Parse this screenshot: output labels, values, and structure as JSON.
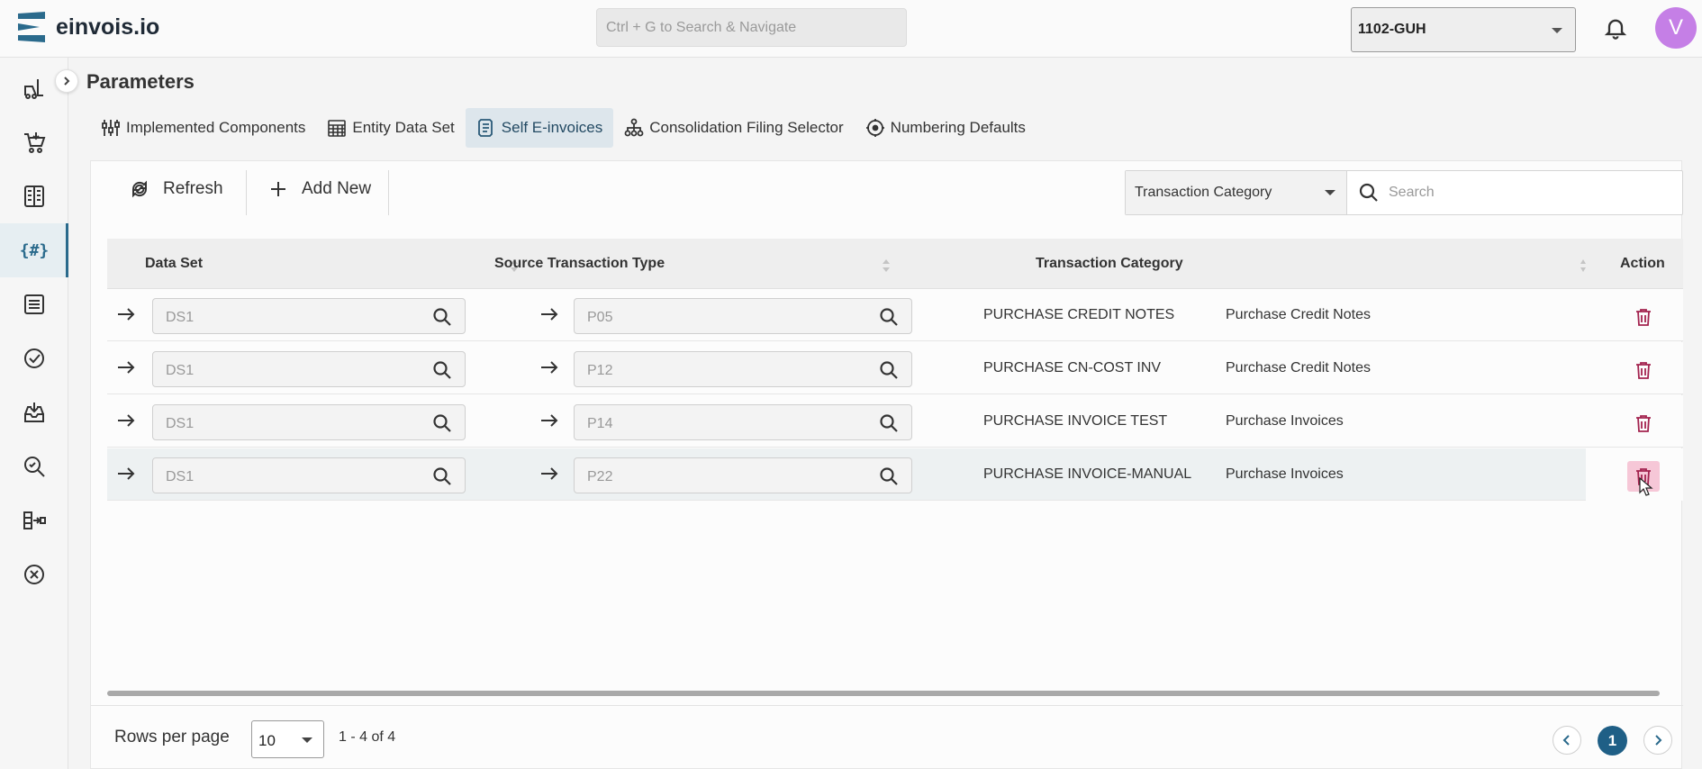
{
  "app": {
    "name": "einvois.io"
  },
  "header": {
    "search_placeholder": "Ctrl + G to Search & Navigate",
    "entity": "1102-GUH",
    "avatar_initial": "V"
  },
  "sidebar": {
    "items": [
      {
        "icon": "forklift-icon"
      },
      {
        "icon": "cart-icon"
      },
      {
        "icon": "ledger-icon"
      },
      {
        "icon": "parameters-icon",
        "label": "{#}",
        "active": true
      },
      {
        "icon": "document-list-icon"
      },
      {
        "icon": "check-circle-icon"
      },
      {
        "icon": "inbox-download-icon"
      },
      {
        "icon": "search-zoom-icon"
      },
      {
        "icon": "transfer-icon"
      },
      {
        "icon": "cancel-circle-icon"
      }
    ]
  },
  "page": {
    "title": "Parameters"
  },
  "tabs": [
    {
      "label": "Implemented Components",
      "icon": "sliders-icon"
    },
    {
      "label": "Entity Data Set",
      "icon": "grid-calendar-icon"
    },
    {
      "label": "Self E-invoices",
      "icon": "receipt-icon",
      "active": true
    },
    {
      "label": "Consolidation Filing Selector",
      "icon": "hierarchy-icon"
    },
    {
      "label": "Numbering Defaults",
      "icon": "target-icon"
    }
  ],
  "toolbar": {
    "refresh_label": "Refresh",
    "add_new_label": "Add New",
    "filter_field": "Transaction Category",
    "search_placeholder": "Search"
  },
  "table": {
    "columns": [
      "Data Set",
      "Source Transaction Type",
      "Transaction Category",
      "Action"
    ],
    "rows": [
      {
        "data_set": "DS1",
        "source_type": "P05",
        "description": "PURCHASE CREDIT NOTES",
        "category": "Purchase Credit Notes"
      },
      {
        "data_set": "DS1",
        "source_type": "P12",
        "description": "PURCHASE CN-COST INV",
        "category": "Purchase Credit Notes"
      },
      {
        "data_set": "DS1",
        "source_type": "P14",
        "description": "PURCHASE INVOICE TEST",
        "category": "Purchase Invoices"
      },
      {
        "data_set": "DS1",
        "source_type": "P22",
        "description": "PURCHASE INVOICE-MANUAL",
        "category": "Purchase Invoices",
        "hovered": true
      }
    ]
  },
  "pagination": {
    "rows_per_page_label": "Rows per page",
    "rows_per_page": "10",
    "range": "1 - 4 of 4",
    "current_page": "1"
  },
  "colors": {
    "accent": "#1f5f86",
    "active_tab_bg": "#dde6ec",
    "delete_icon": "#a3234f",
    "delete_hover_bg": "#f6c7d7",
    "avatar_bg": "#c57fe6"
  }
}
